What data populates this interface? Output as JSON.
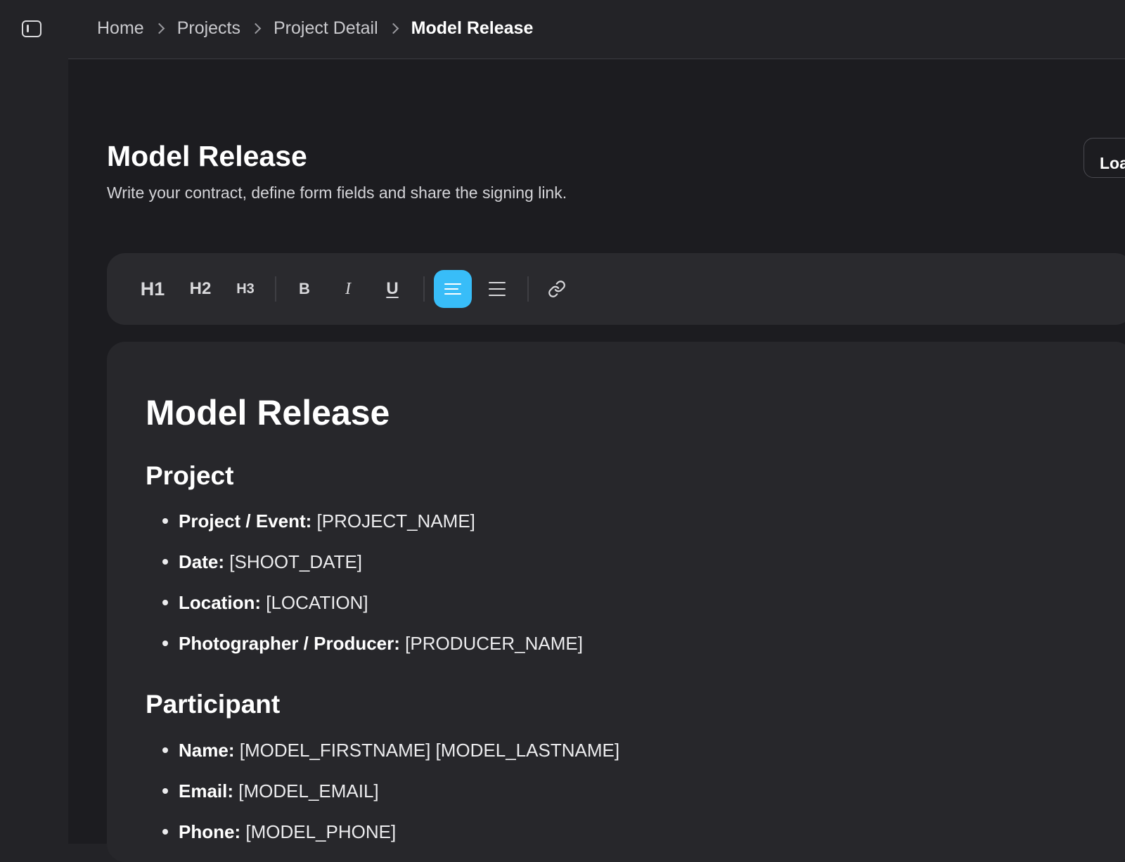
{
  "breadcrumb": {
    "items": [
      "Home",
      "Projects",
      "Project Detail"
    ],
    "current": "Model Release"
  },
  "page": {
    "title": "Model Release",
    "subtitle": "Write your contract, define form fields and share the signing link.",
    "load_button": "Loa"
  },
  "toolbar": {
    "h1": "H1",
    "h2": "H2",
    "h3": "H3",
    "bold": "B",
    "italic": "I",
    "underline": "U",
    "active_button": "align-left",
    "accent_color": "#38bdf8"
  },
  "document": {
    "title": "Model Release",
    "sections": [
      {
        "heading": "Project",
        "items": [
          {
            "label": "Project / Event:",
            "value": "[PROJECT_NAME]"
          },
          {
            "label": "Date:",
            "value": "[SHOOT_DATE]"
          },
          {
            "label": "Location:",
            "value": "[LOCATION]"
          },
          {
            "label": "Photographer / Producer:",
            "value": "[PRODUCER_NAME]"
          }
        ]
      },
      {
        "heading": "Participant",
        "items": [
          {
            "label": "Name:",
            "value": "[MODEL_FIRSTNAME] [MODEL_LASTNAME]"
          },
          {
            "label": "Email:",
            "value": "[MODEL_EMAIL]"
          },
          {
            "label": "Phone:",
            "value": "[MODEL_PHONE]"
          }
        ]
      }
    ]
  }
}
